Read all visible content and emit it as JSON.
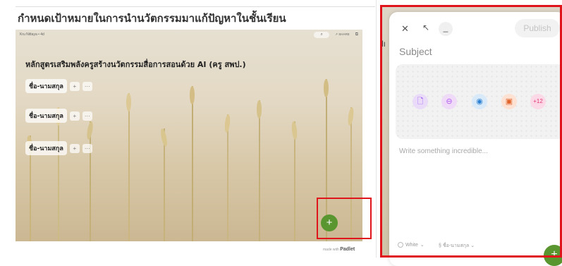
{
  "left": {
    "page_title": "กำหนดเป้าหมายในการนำนวัตกรรมมาแก้ปัญหาในชั้นเรียน",
    "topbar": {
      "author": "Kru Nittaya • 4d",
      "search_icon": "search-icon",
      "share_label": "SHARE",
      "external_icon": "external-link-icon"
    },
    "board_title": "หลักสูตรเสริมพลังครูสร้างนวัตกรรมสื่อการสอนด้วย AI (ครู สพป.)",
    "sections": [
      {
        "label": "ชื่อ-นามสกุล",
        "add": "+",
        "more": "···"
      },
      {
        "label": "ชื่อ-นามสกุล",
        "add": "+",
        "more": "···"
      },
      {
        "label": "ชื่อ-นามสกุล",
        "add": "+",
        "more": "···"
      }
    ],
    "fab_label": "+",
    "made_with_prefix": "made with",
    "made_with_brand": "Padlet"
  },
  "right": {
    "ghost_text": "lı",
    "close_glyph": "✕",
    "expand_glyph": "↖",
    "minimize_glyph": "_",
    "publish_label": "Publish",
    "subject_placeholder": "Subject",
    "attachments": [
      {
        "icon": "file-icon",
        "glyph": "🗋"
      },
      {
        "icon": "link-icon",
        "glyph": "⊖"
      },
      {
        "icon": "camera-icon",
        "glyph": "◉"
      },
      {
        "icon": "image-search-icon",
        "glyph": "▣"
      },
      {
        "icon": "more-attachments",
        "glyph": "+12"
      }
    ],
    "body_placeholder": "Write something incredible...",
    "color_label": "White",
    "section_label": "§ ชื่อ-นามสกุล",
    "fab_label": "+"
  },
  "colors": {
    "accent_green": "#5a9630",
    "highlight_red": "#e0141b"
  }
}
